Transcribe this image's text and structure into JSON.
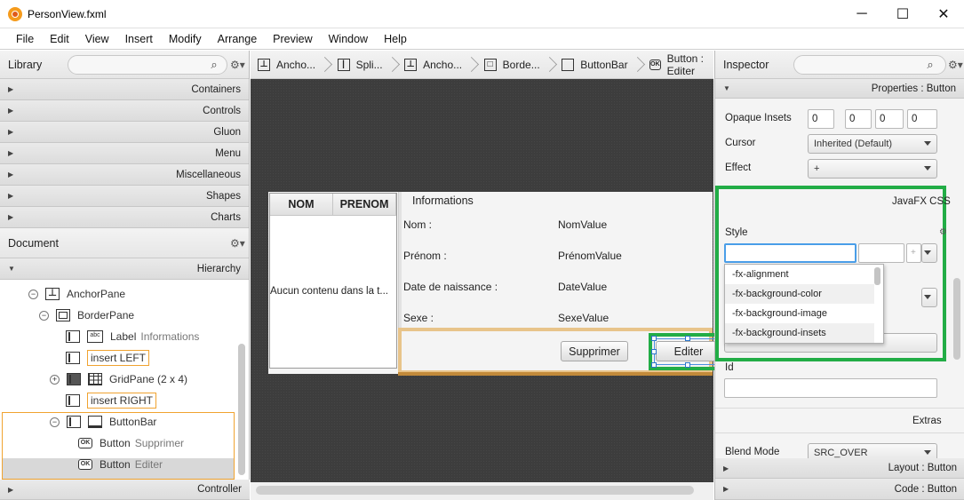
{
  "window": {
    "title": "PersonView.fxml",
    "controls": [
      "─",
      "☐",
      "✕"
    ]
  },
  "menu": [
    "File",
    "Edit",
    "View",
    "Insert",
    "Modify",
    "Arrange",
    "Preview",
    "Window",
    "Help"
  ],
  "library": {
    "title": "Library",
    "sections": [
      "Containers",
      "Controls",
      "Gluon",
      "Menu",
      "Miscellaneous",
      "Shapes",
      "Charts"
    ]
  },
  "document": {
    "title": "Document",
    "hierarchy_label": "Hierarchy",
    "controller_label": "Controller",
    "tree": [
      {
        "label": "AnchorPane",
        "type": ""
      },
      {
        "label": "BorderPane",
        "type": ""
      },
      {
        "label": "Label",
        "type": "Informations"
      },
      {
        "label": "insert LEFT",
        "type": ""
      },
      {
        "label": "GridPane (2 x 4)",
        "type": ""
      },
      {
        "label": "insert RIGHT",
        "type": ""
      },
      {
        "label": "ButtonBar",
        "type": ""
      },
      {
        "label": "Button",
        "type": "Supprimer"
      },
      {
        "label": "Button",
        "type": "Editer"
      }
    ]
  },
  "breadcrumb": [
    "Ancho...",
    "Spli...",
    "Ancho...",
    "Borde...",
    "ButtonBar",
    "Button : Editer"
  ],
  "preview": {
    "table_headers": [
      "NOM",
      "PRENOM"
    ],
    "table_placeholder": "Aucun contenu dans la t...",
    "info_title": "Informations",
    "fields": [
      {
        "label": "Nom :",
        "value": "NomValue"
      },
      {
        "label": "Prénom :",
        "value": "PrénomValue"
      },
      {
        "label": "Date de naissance :",
        "value": "DateValue"
      },
      {
        "label": "Sexe :",
        "value": "SexeValue"
      }
    ],
    "buttons": {
      "delete": "Supprimer",
      "edit": "Editer"
    }
  },
  "inspector": {
    "title": "Inspector",
    "properties_header": "Properties : Button",
    "opaque_insets_label": "Opaque Insets",
    "opaque_insets": [
      "0",
      "0",
      "0",
      "0"
    ],
    "cursor_label": "Cursor",
    "cursor_value": "Inherited (Default)",
    "effect_label": "Effect",
    "effect_value": "+",
    "css_header": "JavaFX CSS",
    "style_label": "Style",
    "style_value": "",
    "style_suggestions": [
      "-fx-alignment",
      "-fx-background-color",
      "-fx-background-image",
      "-fx-background-insets"
    ],
    "id_label": "Id",
    "id_value": "",
    "extras_label": "Extras",
    "blend_mode_label": "Blend Mode",
    "blend_mode_value": "SRC_OVER",
    "layout_header": "Layout : Button",
    "code_header": "Code : Button"
  }
}
